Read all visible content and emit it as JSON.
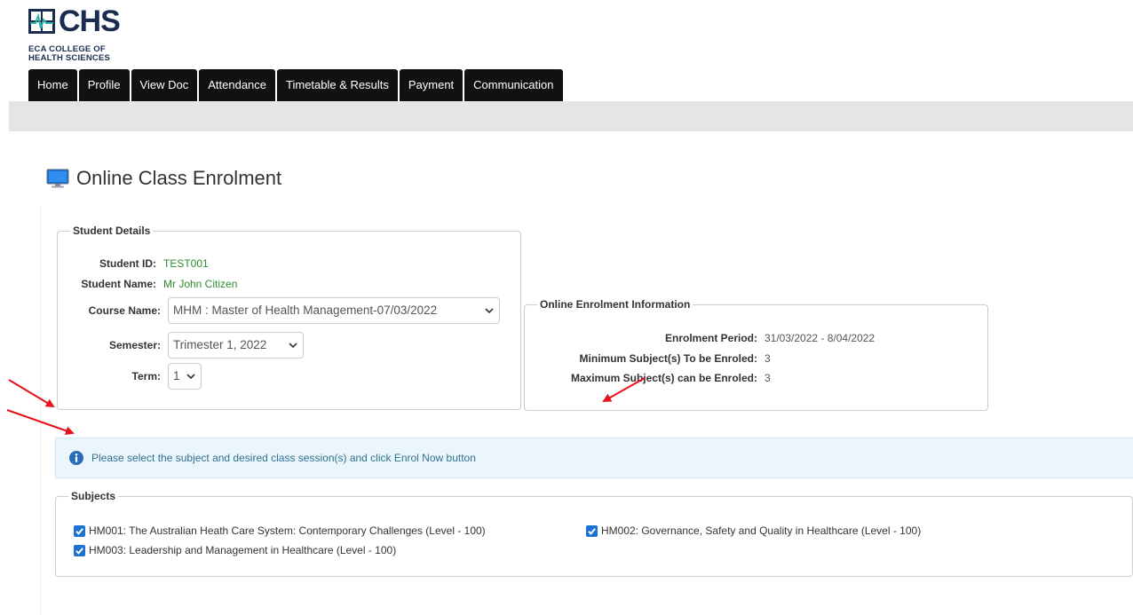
{
  "logo": {
    "name": "CHS",
    "sub_line1": "ECA COLLEGE OF",
    "sub_line2": "HEALTH SCIENCES"
  },
  "nav": {
    "items": [
      "Home",
      "Profile",
      "View Doc",
      "Attendance",
      "Timetable & Results",
      "Payment",
      "Communication"
    ]
  },
  "page": {
    "title": "Online Class Enrolment",
    "icon": "monitor-icon"
  },
  "student_details": {
    "legend": "Student Details",
    "student_id_label": "Student ID:",
    "student_id": "TEST001",
    "student_name_label": "Student Name:",
    "student_name": "Mr John Citizen",
    "course_label": "Course Name:",
    "course_value": "MHM : Master of Health Management-07/03/2022",
    "semester_label": "Semester:",
    "semester_value": "Trimester 1, 2022",
    "term_label": "Term:",
    "term_value": "1"
  },
  "enrolment_info": {
    "legend": "Online Enrolment Information",
    "period_label": "Enrolment Period:",
    "period_value": "31/03/2022 - 8/04/2022",
    "min_label": "Minimum Subject(s) To be Enroled:",
    "min_value": "3",
    "max_label": "Maximum Subject(s) can be Enroled:",
    "max_value": "3"
  },
  "alert": {
    "text": "Please select the subject and desired class session(s) and click Enrol Now button",
    "icon": "info-icon"
  },
  "subjects": {
    "legend": "Subjects",
    "items": [
      {
        "label": "HM001: The Australian Heath Care System: Contemporary Challenges (Level - 100)",
        "checked": true
      },
      {
        "label": "HM002: Governance, Safety and Quality in Healthcare (Level - 100)",
        "checked": true
      },
      {
        "label": "HM003: Leadership and Management in Healthcare (Level - 100)",
        "checked": true
      }
    ]
  },
  "colors": {
    "nav_bg": "#111111",
    "accent_green": "#2e8b2e",
    "alert_bg": "#eaf6fb",
    "checkbox": "#1e73d2",
    "annotation_arrow": "#e8121a"
  }
}
